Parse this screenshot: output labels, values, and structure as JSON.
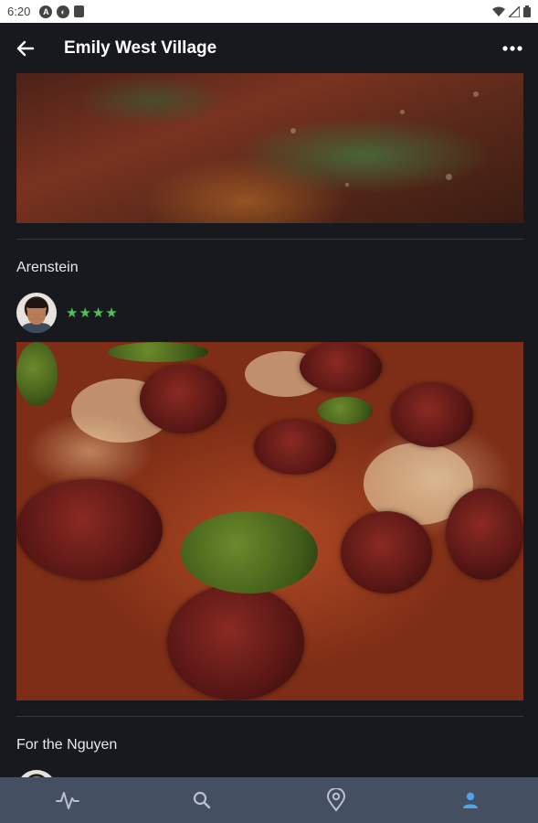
{
  "status_bar": {
    "time": "6:20",
    "icons": [
      "a-icon",
      "sync-icon",
      "sim-icon",
      "wifi-icon",
      "signal-icon",
      "battery-icon"
    ]
  },
  "app_bar": {
    "title": "Emily West Village",
    "back_icon": "arrow-left-icon",
    "more_icon": "more-horizontal-icon"
  },
  "reviews": [
    {
      "name": "Arenstein",
      "rating": 4,
      "stars": "★★★★"
    },
    {
      "name": "For the Nguyen"
    }
  ],
  "bottom_nav": {
    "items": [
      {
        "icon": "activity-icon",
        "active": false
      },
      {
        "icon": "search-icon",
        "active": false
      },
      {
        "icon": "map-pin-icon",
        "active": false
      },
      {
        "icon": "user-icon",
        "active": true
      }
    ]
  },
  "colors": {
    "background": "#17191e",
    "nav_bar": "#445061",
    "star": "#4fc35a",
    "nav_active": "#4ea4e6",
    "nav_inactive": "#b9c1cc"
  }
}
